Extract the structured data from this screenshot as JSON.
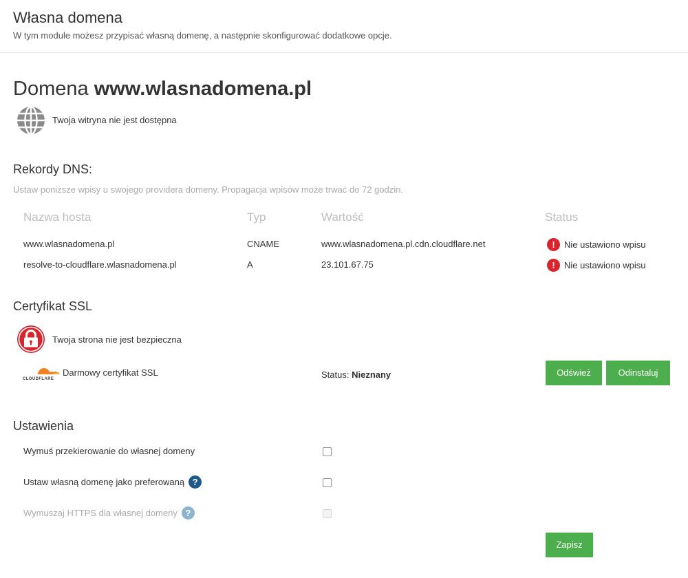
{
  "header": {
    "title": "Własna domena",
    "subtitle": "W tym module możesz przypisać własną domenę, a następnie skonfigurować dodatkowe opcje."
  },
  "domain": {
    "prefix": "Domena",
    "name": "www.wlasnadomena.pl",
    "availability": "Twoja witryna nie jest dostępna"
  },
  "dns": {
    "title": "Rekordy DNS:",
    "description": "Ustaw poniższe wpisy u swojego providera domeny. Propagacja wpisów może trwać do 72 godzin.",
    "columns": [
      "Nazwa hosta",
      "Typ",
      "Wartość",
      "Status"
    ],
    "rows": [
      {
        "host": "www.wlasnadomena.pl",
        "type": "CNAME",
        "value": "www.wlasnadomena.pl.cdn.cloudflare.net",
        "status": "Nie ustawiono wpisu"
      },
      {
        "host": "resolve-to-cloudflare.wlasnadomena.pl",
        "type": "A",
        "value": "23.101.67.75",
        "status": "Nie ustawiono wpisu"
      }
    ]
  },
  "ssl": {
    "title": "Certyfikat SSL",
    "security": "Twoja strona nie jest bezpieczna",
    "provider_logo_text": "CLOUDFLARE",
    "certificate": "Darmowy certyfikat SSL",
    "status_label": "Status:",
    "status_value": "Nieznany",
    "refresh_label": "Odśwież",
    "uninstall_label": "Odinstaluj"
  },
  "settings": {
    "title": "Ustawienia",
    "options": [
      {
        "label": "Wymuś przekierowanie do własnej domeny",
        "checked": false,
        "disabled": false
      },
      {
        "label": "Ustaw własną domenę jako preferowaną",
        "checked": false,
        "disabled": false
      },
      {
        "label": "Wymuszaj HTTPS dla własnej domeny",
        "checked": false,
        "disabled": true
      }
    ],
    "help_glyph": "?",
    "save_label": "Zapisz"
  },
  "icons": {
    "globe": "globe-icon",
    "lock": "lock-icon",
    "error": "error-icon",
    "help": "help-icon",
    "error_glyph": "!"
  },
  "colors": {
    "accent_green": "#4cae4c",
    "error_red": "#d9232d",
    "help_blue": "#1c5a89"
  }
}
